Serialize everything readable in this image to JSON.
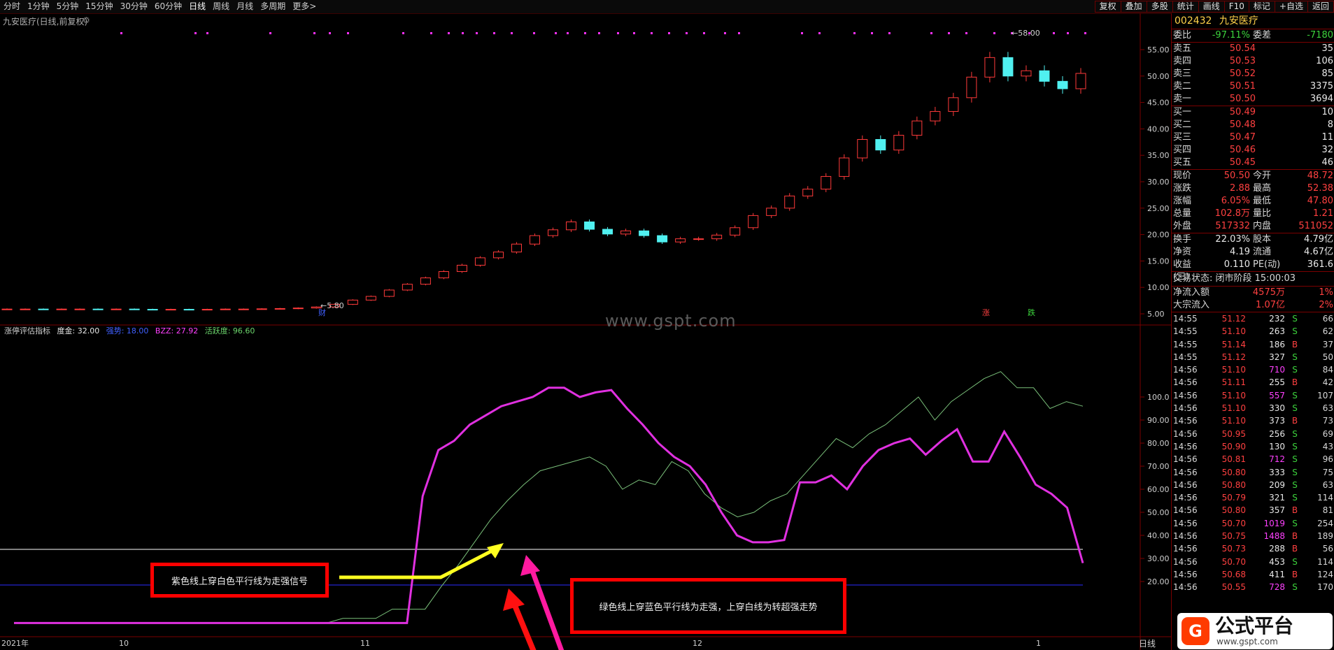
{
  "periods": [
    "分时",
    "1分钟",
    "5分钟",
    "15分钟",
    "30分钟",
    "60分钟",
    "日线",
    "周线",
    "月线",
    "多周期",
    "更多>"
  ],
  "tools": [
    "复权",
    "叠加",
    "多股",
    "统计",
    "画线",
    "F10",
    "标记",
    "+自选",
    "返回"
  ],
  "stock_label": "九安医疗(日线,前复权)",
  "gear_icon": "gear-icon",
  "price_axis": [
    "55.00",
    "50.00",
    "45.00",
    "40.00",
    "35.00",
    "30.00",
    "25.00",
    "20.00",
    "15.00",
    "10.00",
    "5.00"
  ],
  "high_marker": "58.00",
  "low_marker": "5.80",
  "event_labels": {
    "cai": "财",
    "zhang": "涨",
    "die": "跌"
  },
  "indicator": {
    "name": "涨停评估指标",
    "t1": "度金: 32.00",
    "t2": "强势: 18.00",
    "t3": "BZZ: 27.92",
    "t4": "活跃度: 96.60"
  },
  "ind_axis": [
    "100.0",
    "90.00",
    "80.00",
    "70.00",
    "60.00",
    "50.00",
    "40.00",
    "30.00",
    "20.00"
  ],
  "time_axis": {
    "a": "2021年",
    "b": "10",
    "c": "11",
    "d": "12",
    "e": "1"
  },
  "day_label": "日线",
  "watermark": "www.gspt.com",
  "annotations": {
    "purple": "紫色线上穿白色平行线为走强信号",
    "green": "绿色线上穿蓝色平行线为走强，上穿白线为转超强走势"
  },
  "quote": {
    "code": "002432",
    "name": "九安医疗",
    "weibi_label": "委比",
    "weibi": "-97.11%",
    "weicha_label": "委差",
    "weicha": "-7180",
    "sell": [
      {
        "label": "卖五",
        "price": "50.54",
        "vol": "35"
      },
      {
        "label": "卖四",
        "price": "50.53",
        "vol": "106"
      },
      {
        "label": "卖三",
        "price": "50.52",
        "vol": "85"
      },
      {
        "label": "卖二",
        "price": "50.51",
        "vol": "3375"
      },
      {
        "label": "卖一",
        "price": "50.50",
        "vol": "3694"
      }
    ],
    "buy": [
      {
        "label": "买一",
        "price": "50.49",
        "vol": "10"
      },
      {
        "label": "买二",
        "price": "50.48",
        "vol": "8"
      },
      {
        "label": "买三",
        "price": "50.47",
        "vol": "11"
      },
      {
        "label": "买四",
        "price": "50.46",
        "vol": "32"
      },
      {
        "label": "买五",
        "price": "50.45",
        "vol": "46"
      }
    ],
    "stats": [
      {
        "l1": "现价",
        "v1": "50.50",
        "l2": "今开",
        "v2": "48.72"
      },
      {
        "l1": "涨跌",
        "v1": "2.88",
        "l2": "最高",
        "v2": "52.38"
      },
      {
        "l1": "涨幅",
        "v1": "6.05%",
        "l2": "最低",
        "v2": "47.80"
      },
      {
        "l1": "总量",
        "v1": "102.8万",
        "l2": "量比",
        "v2": "1.21"
      },
      {
        "l1": "外盘",
        "v1": "517332",
        "l2": "内盘",
        "v2": "511052"
      }
    ],
    "stats2": [
      {
        "l1": "换手",
        "v1": "22.03%",
        "l2": "股本",
        "v2": "4.79亿"
      },
      {
        "l1": "净资",
        "v1": "4.19",
        "l2": "流通",
        "v2": "4.67亿"
      },
      {
        "l1": "收益(三)",
        "v1": "0.110",
        "l2": "PE(动)",
        "v2": "361.6"
      }
    ],
    "status": "交易状态: 闭市阶段 15:00:03",
    "flows": [
      {
        "l": "净流入额",
        "v": "4575万",
        "p": "1%"
      },
      {
        "l": "大宗流入",
        "v": "1.07亿",
        "p": "2%"
      }
    ]
  },
  "ticks": [
    {
      "t": "14:55",
      "p": "51.12",
      "q": "232",
      "s": "S",
      "n": "66"
    },
    {
      "t": "14:55",
      "p": "51.10",
      "q": "263",
      "s": "S",
      "n": "62"
    },
    {
      "t": "14:55",
      "p": "51.14",
      "q": "186",
      "s": "B",
      "n": "37"
    },
    {
      "t": "14:55",
      "p": "51.12",
      "q": "327",
      "s": "S",
      "n": "50"
    },
    {
      "t": "14:56",
      "p": "51.10",
      "q": "710",
      "s": "S",
      "n": "84"
    },
    {
      "t": "14:56",
      "p": "51.11",
      "q": "255",
      "s": "B",
      "n": "42"
    },
    {
      "t": "14:56",
      "p": "51.10",
      "q": "557",
      "s": "S",
      "n": "107"
    },
    {
      "t": "14:56",
      "p": "51.10",
      "q": "330",
      "s": "S",
      "n": "63"
    },
    {
      "t": "14:56",
      "p": "51.10",
      "q": "373",
      "s": "B",
      "n": "73"
    },
    {
      "t": "14:56",
      "p": "50.95",
      "q": "256",
      "s": "S",
      "n": "69"
    },
    {
      "t": "14:56",
      "p": "50.90",
      "q": "130",
      "s": "S",
      "n": "43"
    },
    {
      "t": "14:56",
      "p": "50.81",
      "q": "712",
      "s": "S",
      "n": "96"
    },
    {
      "t": "14:56",
      "p": "50.80",
      "q": "333",
      "s": "S",
      "n": "75"
    },
    {
      "t": "14:56",
      "p": "50.80",
      "q": "209",
      "s": "S",
      "n": "63"
    },
    {
      "t": "14:56",
      "p": "50.79",
      "q": "321",
      "s": "S",
      "n": "114"
    },
    {
      "t": "14:56",
      "p": "50.80",
      "q": "357",
      "s": "B",
      "n": "81"
    },
    {
      "t": "14:56",
      "p": "50.70",
      "q": "1019",
      "s": "S",
      "n": "254"
    },
    {
      "t": "14:56",
      "p": "50.75",
      "q": "1488",
      "s": "B",
      "n": "189"
    },
    {
      "t": "14:56",
      "p": "50.73",
      "q": "288",
      "s": "B",
      "n": "56"
    },
    {
      "t": "14:56",
      "p": "50.70",
      "q": "453",
      "s": "S",
      "n": "114"
    },
    {
      "t": "14:56",
      "p": "50.68",
      "q": "411",
      "s": "B",
      "n": "124"
    },
    {
      "t": "14:56",
      "p": "50.55",
      "q": "728",
      "s": "S",
      "n": "170"
    }
  ],
  "logo": {
    "mark": "G",
    "title": "公式平台",
    "url": "www.gspt.com"
  }
}
